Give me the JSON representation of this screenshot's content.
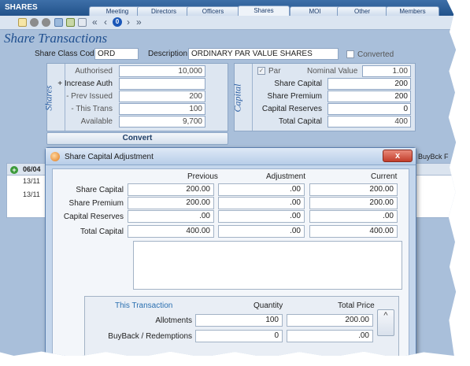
{
  "app": {
    "title": "SHARES"
  },
  "tabs": [
    {
      "label": "Meeting",
      "active": false
    },
    {
      "label": "Directors",
      "active": false
    },
    {
      "label": "Officers",
      "active": false
    },
    {
      "label": "Shares",
      "active": true
    },
    {
      "label": "MOI",
      "active": false
    },
    {
      "label": "Other",
      "active": false
    },
    {
      "label": "Members",
      "active": false
    }
  ],
  "toolbar": {
    "icons": [
      "new-icon",
      "stop-icon",
      "stop2-icon",
      "link-icon",
      "edit-icon",
      "print-icon",
      "first-icon",
      "prev-icon",
      "record-number",
      "next-icon",
      "last-icon"
    ],
    "record_number": "0"
  },
  "page": {
    "title": "Share Transactions"
  },
  "share_class": {
    "code_label": "Share Class Code",
    "code_value": "ORD",
    "desc_label": "Description",
    "desc_value": "ORDINARY PAR VALUE SHARES",
    "converted_label": "Converted"
  },
  "shares_panel": {
    "title": "Shares",
    "rows": [
      {
        "label": "Authorised",
        "value": "10,000"
      },
      {
        "label": "+ Increase Auth",
        "value": ""
      },
      {
        "label": "- Prev Issued",
        "value": "200"
      },
      {
        "label": "- This Trans",
        "value": "100"
      },
      {
        "label": "Available",
        "value": "9,700"
      }
    ]
  },
  "capital_panel": {
    "title": "Capital",
    "par_label": "Par",
    "par_checked": true,
    "nominal_label": "Nominal Value",
    "nominal_value": "1.00",
    "rows": [
      {
        "label": "Share Capital",
        "value": "200"
      },
      {
        "label": "Share Premium",
        "value": "200"
      },
      {
        "label": "Capital Reserves",
        "value": "0"
      },
      {
        "label": "Total Capital",
        "value": "400"
      }
    ]
  },
  "convert_button": "Convert",
  "grid": {
    "header_partial": "06/04",
    "right_header_partial": "BuyBck F",
    "rows": [
      "13/11",
      "13/11"
    ]
  },
  "dialog": {
    "title": "Share Capital Adjustment",
    "close_label": "x",
    "col_previous": "Previous",
    "col_adjustment": "Adjustment",
    "col_current": "Current",
    "rows": [
      {
        "label": "Share Capital",
        "previous": "200.00",
        "adjustment": ".00",
        "current": "200.00"
      },
      {
        "label": "Share Premium",
        "previous": "200.00",
        "adjustment": ".00",
        "current": "200.00"
      },
      {
        "label": "Capital Reserves",
        "previous": ".00",
        "adjustment": ".00",
        "current": ".00"
      },
      {
        "label": "Total Capital",
        "previous": "400.00",
        "adjustment": ".00",
        "current": "400.00"
      }
    ],
    "transaction": {
      "heading": "This Transaction",
      "col_quantity": "Quantity",
      "col_total": "Total Price",
      "rows": [
        {
          "label": "Allotments",
          "quantity": "100",
          "total": "200.00"
        },
        {
          "label": "BuyBack / Redemptions",
          "quantity": "0",
          "total": ".00"
        }
      ],
      "scroll_label": "^"
    }
  },
  "colors": {
    "accent": "#2a5ea3",
    "header": "#22528a",
    "background": "#a9bfda",
    "close": "#c23d2b"
  }
}
